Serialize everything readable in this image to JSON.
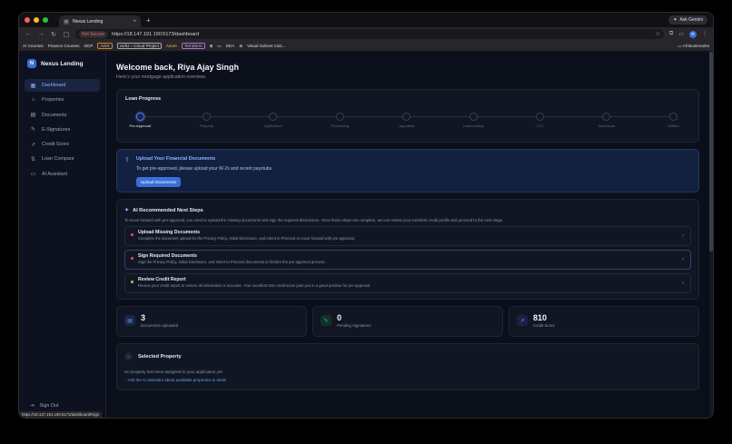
{
  "browser": {
    "tab_title": "Nexus Lending",
    "new_tab": "+",
    "ask_button": "Ask Gemini",
    "not_secure": "Not Secure",
    "url": "https://18.147.191.190:5173/dashboard",
    "profile_initial": "R",
    "bookmarks": [
      "AI Courses",
      "Finance Courses",
      "GCP",
      "AWS",
      "UofU – Cloud Project",
      "Azure",
      "Terraform",
      "DEA",
      "Visual Subnet Calc..."
    ],
    "all_bookmarks": "All Bookmarks",
    "status_url": "https://18.147.191.190:5173/dashboard#sign"
  },
  "colors": {
    "accent": "#3b6fd8",
    "red_light": "#ff5f57",
    "yellow_light": "#febc2e",
    "green_light": "#28c840"
  },
  "sidebar": {
    "logo_letter": "N",
    "brand": "Nexus Lending",
    "items": [
      {
        "label": "Dashboard",
        "icon": "grid-icon"
      },
      {
        "label": "Properties",
        "icon": "home-icon"
      },
      {
        "label": "Documents",
        "icon": "document-icon"
      },
      {
        "label": "E-Signatures",
        "icon": "pen-icon"
      },
      {
        "label": "Credit Score",
        "icon": "trend-icon"
      },
      {
        "label": "Loan Compare",
        "icon": "compare-icon"
      },
      {
        "label": "AI Assistant",
        "icon": "chat-icon"
      }
    ],
    "signout": "Sign Out"
  },
  "main": {
    "welcome": "Welcome back, Riya Ajay Singh",
    "subtitle": "Here's your mortgage application overview.",
    "progress": {
      "title": "Loan Progress",
      "steps": [
        "Pre-Approval",
        "Property",
        "Application",
        "Processing",
        "Appraisal",
        "Underwriting",
        "CTC",
        "Disclosure",
        "Settled"
      ],
      "current_index": 0
    },
    "upload": {
      "title": "Upload Your Financial Documents",
      "desc": "To get pre-approved, please upload your W-2s and recent paystubs.",
      "button": "Upload Documents"
    },
    "ai": {
      "title": "AI Recommended Next Steps",
      "desc": "To move forward with pre-approval, you need to upload the missing documents and sign the required disclosures. Once those steps are complete, we can review your excellent credit profile and proceed to the next stage.",
      "items": [
        {
          "title": "Upload Missing Documents",
          "desc": "Complete the document upload for the Privacy Policy, Initial Disclosure, and Intent to Proceed to move forward with pre-approval.",
          "color": "#e05252"
        },
        {
          "title": "Sign Required Documents",
          "desc": "Sign the Privacy Policy, Initial Disclosure, and Intent to Proceed documents to finalize the pre-approval process.",
          "color": "#e05252"
        },
        {
          "title": "Review Credit Report",
          "desc": "Review your credit report to ensure all information is accurate. Your excellent 810 credit score puts you in a great position for pre-approval.",
          "color": "#e0b23a"
        }
      ]
    },
    "stats": [
      {
        "value": "3",
        "label": "Documents Uploaded",
        "icon": "document-icon",
        "color": "#3b6fd8"
      },
      {
        "value": "0",
        "label": "Pending Signatures",
        "icon": "pen-icon",
        "color": "#2bb37a"
      },
      {
        "value": "810",
        "label": "Credit Score",
        "icon": "trend-icon",
        "color": "#7c5cf0"
      }
    ],
    "property": {
      "title": "Selected Property",
      "desc": "No property has been assigned to your application yet.",
      "link": "Ask the AI assistant about available properties & deals"
    }
  }
}
